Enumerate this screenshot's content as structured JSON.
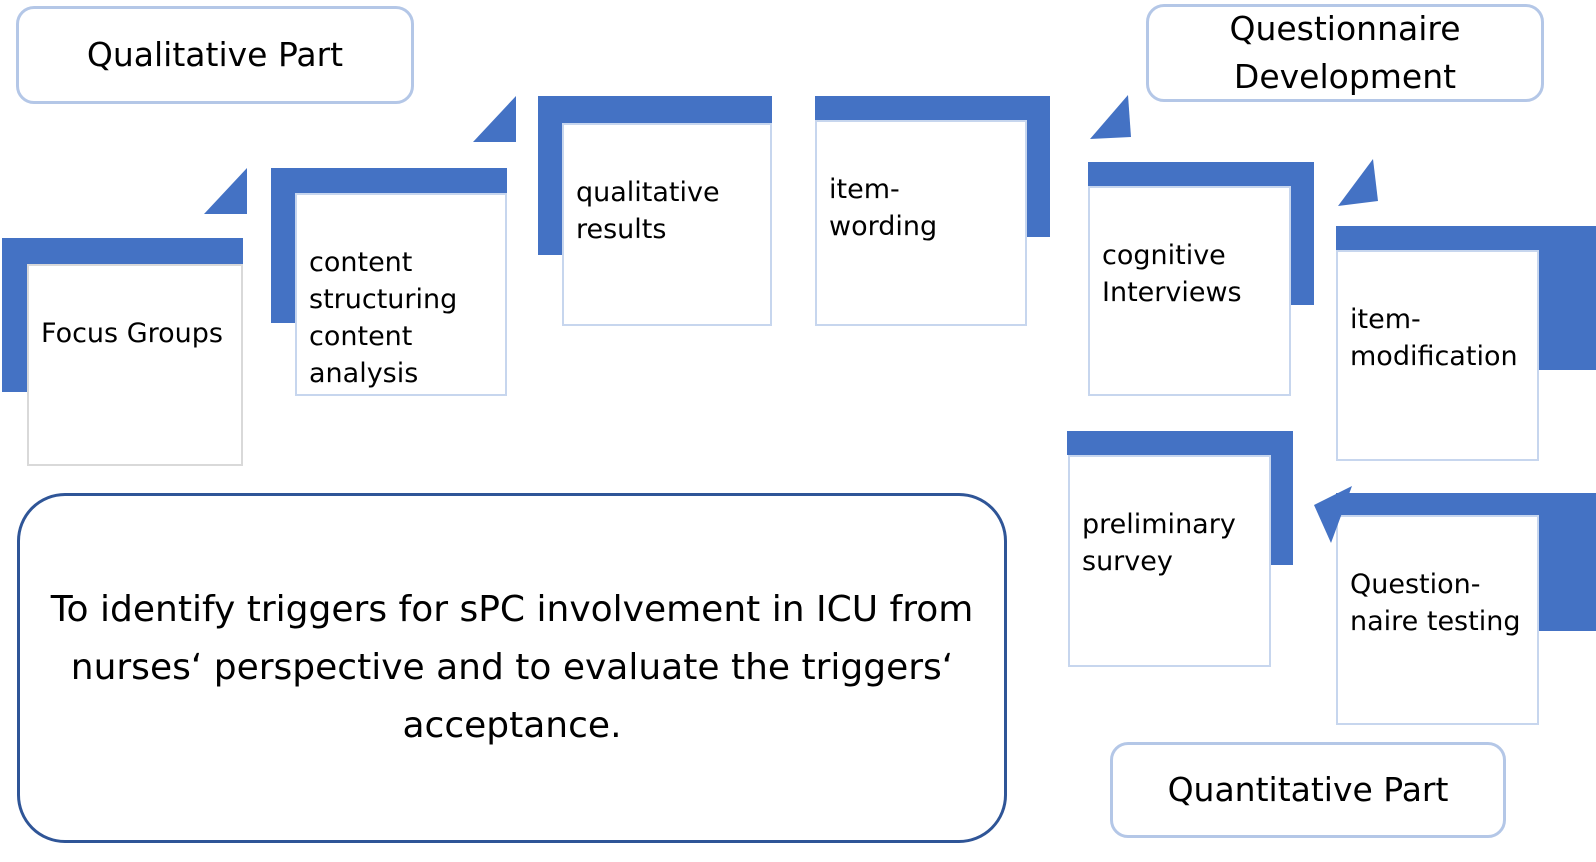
{
  "headers": {
    "qualitative": "Qualitative Part",
    "questionnaire_development": "Questionnaire\nDevelopment",
    "quantitative": "Quantitative Part"
  },
  "steps": [
    {
      "id": "focus-groups",
      "label": "Focus Groups",
      "phase": "qualitative"
    },
    {
      "id": "content-structuring",
      "label": "content\nstructuring\ncontent\nanalysis",
      "phase": "qualitative"
    },
    {
      "id": "qualitative-results",
      "label": "qualitative\nresults",
      "phase": "questionnaire_development"
    },
    {
      "id": "item-wording",
      "label": "item-\nwording",
      "phase": "questionnaire_development"
    },
    {
      "id": "cognitive-interviews",
      "label": "cognitive\nInterviews",
      "phase": "questionnaire_development"
    },
    {
      "id": "item-modification",
      "label": "item-\nmodification",
      "phase": "questionnaire_development"
    },
    {
      "id": "questionnaire-testing",
      "label": "Question-\nnaire testing",
      "phase": "quantitative"
    },
    {
      "id": "preliminary-survey",
      "label": "preliminary\nsurvey",
      "phase": "quantitative"
    }
  ],
  "goal": "To identify triggers for sPC involvement in ICU from nurses‘ perspective and to evaluate the triggers‘ acceptance.",
  "colors": {
    "accent": "#4472c4",
    "header_border": "#b4c7e7",
    "goal_border": "#2f5597"
  }
}
